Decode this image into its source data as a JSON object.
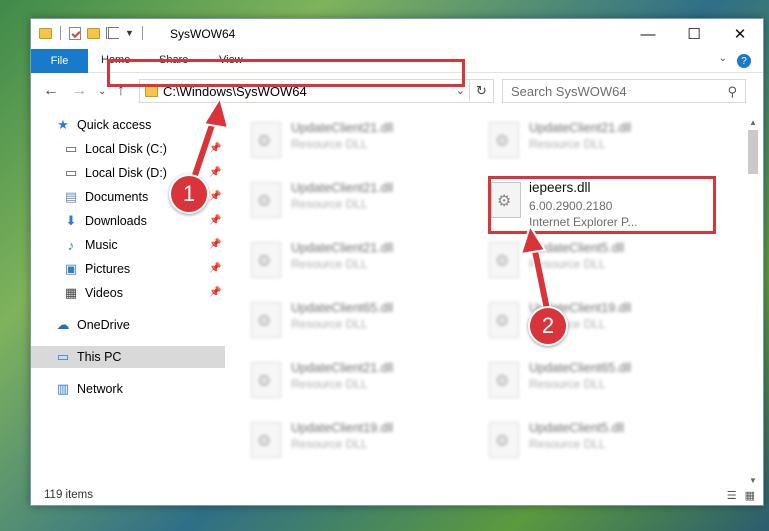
{
  "window": {
    "title": "SysWOW64",
    "controls": {
      "minimize": "—",
      "maximize": "☐",
      "close": "✕"
    }
  },
  "ribbon": {
    "file_tab": "File",
    "tabs": [
      "Home",
      "Share",
      "View"
    ],
    "help": "?"
  },
  "address": {
    "path": "C:\\Windows\\SysWOW64",
    "search_placeholder": "Search SysWOW64"
  },
  "navigation": {
    "quick_access": "Quick access",
    "items": [
      {
        "label": "Local Disk (C:)",
        "icon": "drive-icon"
      },
      {
        "label": "Local Disk (D:)",
        "icon": "drive-icon"
      },
      {
        "label": "Documents",
        "icon": "documents-icon"
      },
      {
        "label": "Downloads",
        "icon": "downloads-icon"
      },
      {
        "label": "Music",
        "icon": "music-icon"
      },
      {
        "label": "Pictures",
        "icon": "pictures-icon"
      },
      {
        "label": "Videos",
        "icon": "videos-icon"
      }
    ],
    "onedrive": "OneDrive",
    "this_pc": "This PC",
    "network": "Network"
  },
  "files": {
    "target": {
      "name": "iepeers.dll",
      "version": "6.00.2900.2180",
      "description": "Internet Explorer P..."
    },
    "left_column": [
      {
        "name": "UpdateClient21.dll",
        "desc": "Resource DLL"
      },
      {
        "name": "UpdateClient21.dll",
        "desc": "Resource DLL"
      },
      {
        "name": "UpdateClient21.dll",
        "desc": "Resource DLL"
      },
      {
        "name": "UpdateClient65.dll",
        "desc": "Resource DLL"
      },
      {
        "name": "UpdateClient21.dll",
        "desc": "Resource DLL"
      },
      {
        "name": "UpdateClient19.dll",
        "desc": "Resource DLL"
      }
    ],
    "right_column": [
      {
        "name": "UpdateClient21.dll",
        "desc": "Resource DLL"
      },
      {
        "name": "UpdateClient5.dll",
        "desc": "Resource DLL"
      },
      {
        "name": "UpdateClient19.dll",
        "desc": "Resource DLL"
      },
      {
        "name": "UpdateClient65.dll",
        "desc": "Resource DLL"
      },
      {
        "name": "UpdateClient5.dll",
        "desc": "Resource DLL"
      }
    ]
  },
  "status": {
    "item_count": "119 items"
  },
  "annotations": {
    "step1": "1",
    "step2": "2",
    "color": "#d8343a"
  }
}
